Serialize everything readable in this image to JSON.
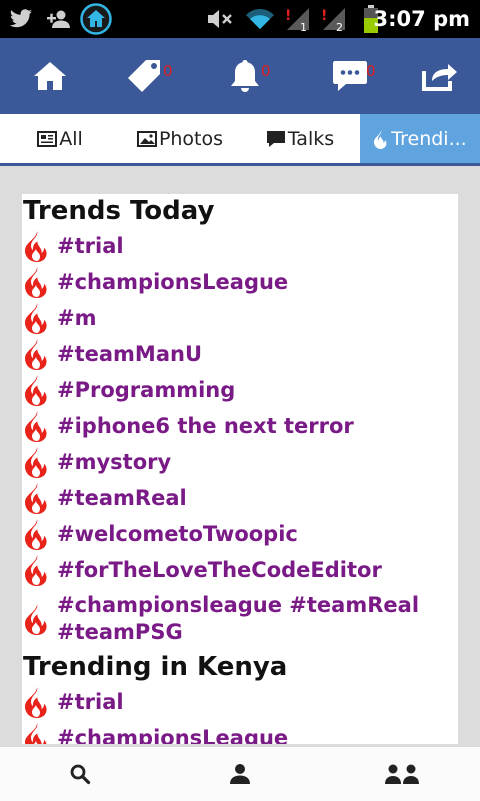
{
  "statusbar": {
    "time": "3:07 pm",
    "signal_1": "1",
    "signal_2": "2"
  },
  "navbar": {
    "items": [
      {
        "icon": "home-icon"
      },
      {
        "icon": "tag-icon",
        "count": "0"
      },
      {
        "icon": "bell-icon",
        "count": "0"
      },
      {
        "icon": "chat-icon",
        "count": "0"
      },
      {
        "icon": "share-icon"
      }
    ]
  },
  "tabs": [
    {
      "label": "All",
      "icon": "newspaper-icon"
    },
    {
      "label": "Photos",
      "icon": "image-icon"
    },
    {
      "label": "Talks",
      "icon": "speech-bubble-icon"
    },
    {
      "label": "Trendi...",
      "icon": "flame-icon",
      "active": true
    }
  ],
  "sections": [
    {
      "title": "Trends Today",
      "items": [
        "#trial",
        "#championsLeague",
        "#m",
        "#teamManU",
        "#Programming",
        "#iphone6 the next terror",
        "#mystory",
        "#teamReal",
        "#welcometoTwoopic",
        "#forTheLoveTheCodeEditor",
        "#championsleague #teamReal #teamPSG"
      ]
    },
    {
      "title": "Trending in Kenya",
      "items": [
        "#trial",
        "#championsLeague"
      ]
    }
  ],
  "bottombar": {
    "items": [
      "search-icon",
      "person-icon",
      "people-icon"
    ]
  },
  "colors": {
    "nav": "#3b5998",
    "active_tab": "#5fa4de",
    "hashtag": "#7a1a86",
    "flame": "#e8231a",
    "count": "#e02020"
  }
}
